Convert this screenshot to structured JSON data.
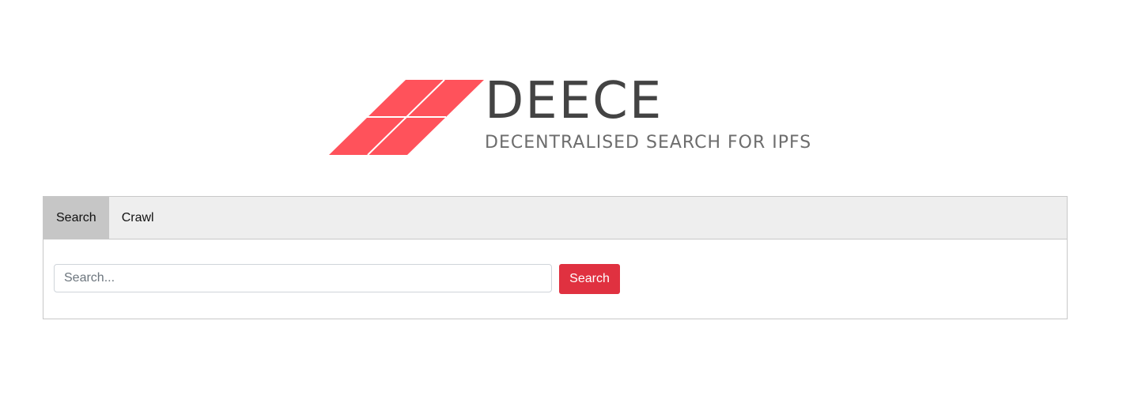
{
  "logo": {
    "title": "DEECE",
    "subtitle": "DECENTRALISED SEARCH FOR IPFS",
    "mark_color": "#ff525b"
  },
  "tabs": [
    {
      "label": "Search",
      "active": true
    },
    {
      "label": "Crawl",
      "active": false
    }
  ],
  "search": {
    "placeholder": "Search...",
    "value": "",
    "button_label": "Search",
    "button_color": "#e03140"
  }
}
